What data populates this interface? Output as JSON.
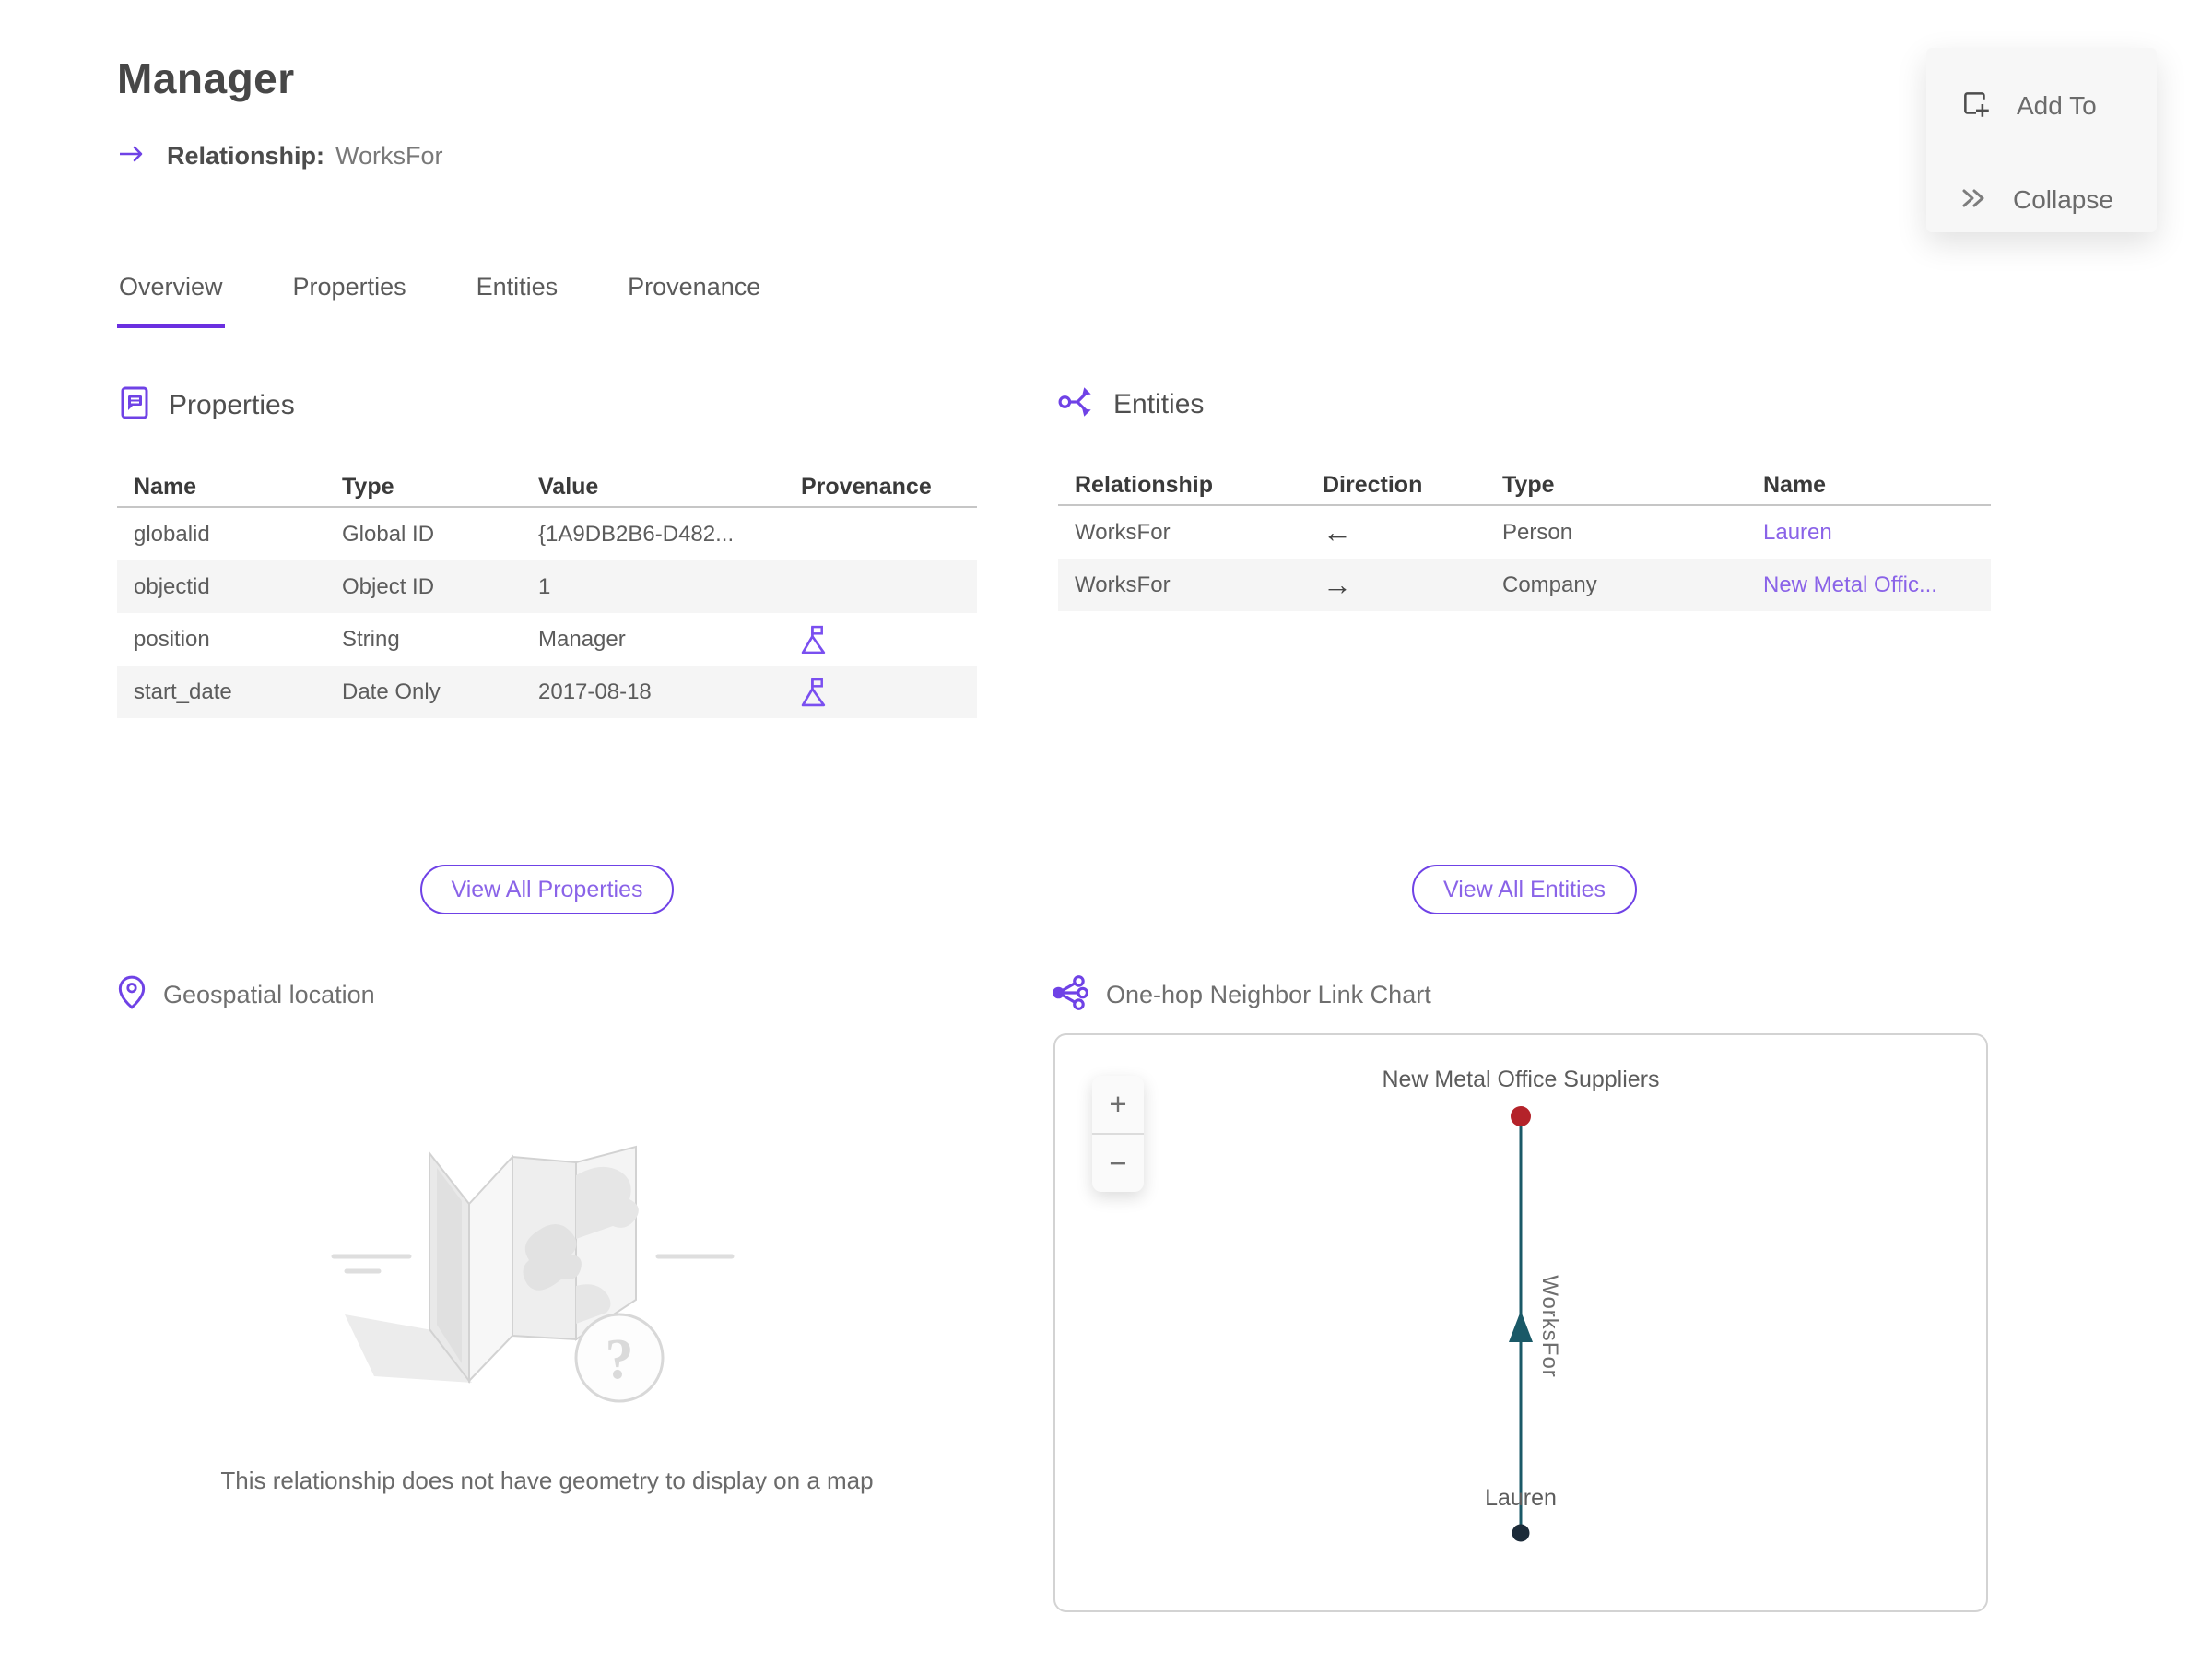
{
  "header": {
    "title": "Manager",
    "relationship_label": "Relationship:",
    "relationship_value": "WorksFor"
  },
  "actions": {
    "add_to": "Add To",
    "collapse": "Collapse"
  },
  "tabs": [
    {
      "label": "Overview",
      "active": true
    },
    {
      "label": "Properties",
      "active": false
    },
    {
      "label": "Entities",
      "active": false
    },
    {
      "label": "Provenance",
      "active": false
    }
  ],
  "properties": {
    "title": "Properties",
    "columns": [
      "Name",
      "Type",
      "Value",
      "Provenance"
    ],
    "rows": [
      {
        "name": "globalid",
        "type": "Global ID",
        "value": "{1A9DB2B6-D482...",
        "has_provenance": false
      },
      {
        "name": "objectid",
        "type": "Object ID",
        "value": "1",
        "has_provenance": false
      },
      {
        "name": "position",
        "type": "String",
        "value": "Manager",
        "has_provenance": true
      },
      {
        "name": "start_date",
        "type": "Date Only",
        "value": "2017-08-18",
        "has_provenance": true
      }
    ],
    "view_all": "View All Properties"
  },
  "entities": {
    "title": "Entities",
    "columns": [
      "Relationship",
      "Direction",
      "Type",
      "Name"
    ],
    "rows": [
      {
        "relationship": "WorksFor",
        "direction": "←",
        "type": "Person",
        "name": "Lauren"
      },
      {
        "relationship": "WorksFor",
        "direction": "→",
        "type": "Company",
        "name": "New Metal Offic..."
      }
    ],
    "view_all": "View All Entities"
  },
  "geospatial": {
    "title": "Geospatial location",
    "empty_message": "This relationship does not have geometry to display on a map"
  },
  "link_chart": {
    "title": "One-hop Neighbor Link Chart",
    "zoom_in": "+",
    "zoom_out": "−",
    "nodes": [
      {
        "label": "New Metal Office Suppliers",
        "type": "Company",
        "color": "#b4232a"
      },
      {
        "label": "Lauren",
        "type": "Person",
        "color": "#1c2b39"
      }
    ],
    "edge": {
      "label": "WorksFor",
      "color": "#1a5967",
      "direction": "up"
    }
  },
  "colors": {
    "accent_purple": "#6f42e6",
    "tab_underline": "#6b2fe0",
    "link_purple": "#8a63e8",
    "edge_teal": "#1a5967",
    "node_red": "#b4232a",
    "node_navy": "#1c2b39",
    "row_stripe": "#f5f5f5"
  }
}
